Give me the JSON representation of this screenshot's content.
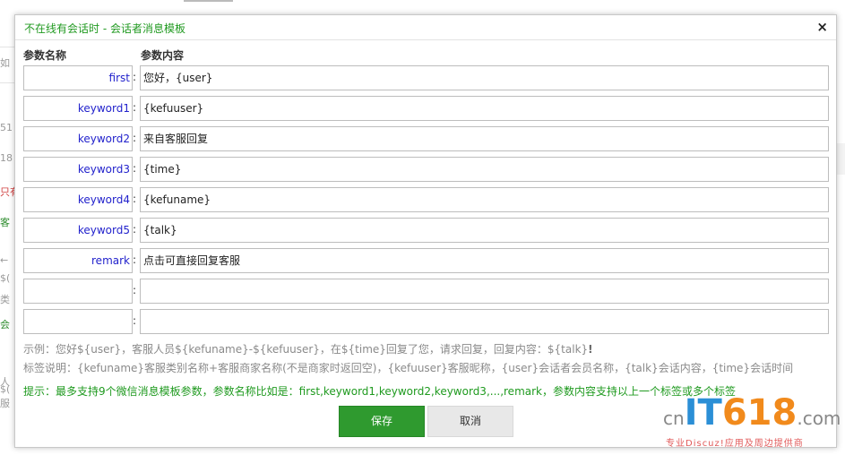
{
  "background": {
    "fragments": [
      "如",
      "51",
      "18",
      "只有",
      "客",
      "←",
      "$(",
      "类",
      "会",
      "人",
      "$(",
      "服"
    ]
  },
  "dialog": {
    "title": "不在线有会话时 - 会话者消息模板",
    "close_symbol": "×",
    "header_name": "参数名称",
    "header_value": "参数内容",
    "colon": ":",
    "params": [
      {
        "name": "first",
        "value": "您好，{user}"
      },
      {
        "name": "keyword1",
        "value": "{kefuuser}"
      },
      {
        "name": "keyword2",
        "value": "来自客服回复"
      },
      {
        "name": "keyword3",
        "value": "{time}"
      },
      {
        "name": "keyword4",
        "value": "{kefuname}"
      },
      {
        "name": "keyword5",
        "value": "{talk}"
      },
      {
        "name": "remark",
        "value": "点击可直接回复客服"
      },
      {
        "name": "",
        "value": ""
      },
      {
        "name": "",
        "value": ""
      }
    ],
    "example": "示例：您好${user}，客服人员${kefuname}-${kefuuser}，在${time}回复了您，请求回复，回复内容：${talk}",
    "example_end": "!",
    "tag_note": "标签说明：{kefuname}客服类别名称+客服商家名称(不是商家时返回空)，{kefuuser}客服昵称，{user}会话者会员名称，{talk}会话内容，{time}会话时间",
    "tip": "提示：最多支持9个微信消息模板参数，参数名称比如是：first,keyword1,keyword2,keyword3,...,remark，参数内容支持以上一个标签或多个标签",
    "save_label": "保存",
    "cancel_label": "取消"
  },
  "watermark": {
    "cn": "cn",
    "it": "IT",
    "num": "618",
    "com": ".com",
    "sub": "专业Discuz!应用及周边提供商"
  },
  "colors": {
    "title_green": "#219a21",
    "save_green": "#2f9a2f",
    "param_name_blue": "#2222cc",
    "tip_green": "#1f9a1f"
  }
}
